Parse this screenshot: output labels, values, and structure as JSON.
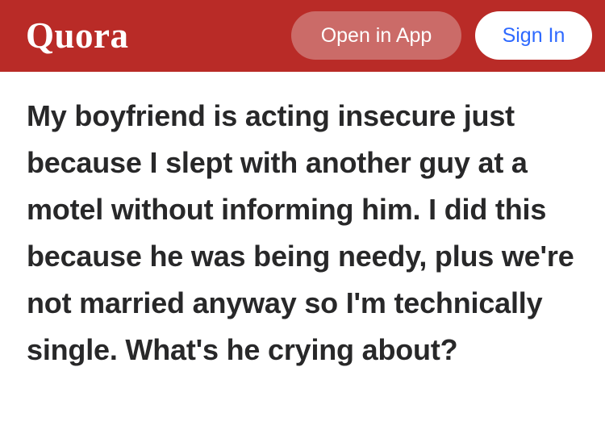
{
  "header": {
    "logo_text": "Quora",
    "open_in_app_label": "Open in App",
    "sign_in_label": "Sign In",
    "background_color": "#b92b27"
  },
  "question": {
    "title": "My boyfriend is acting insecure just because I slept with another guy at a motel without informing him. I did this because he was being needy, plus we're not married anyway so I'm technically single. What's he crying about?"
  }
}
